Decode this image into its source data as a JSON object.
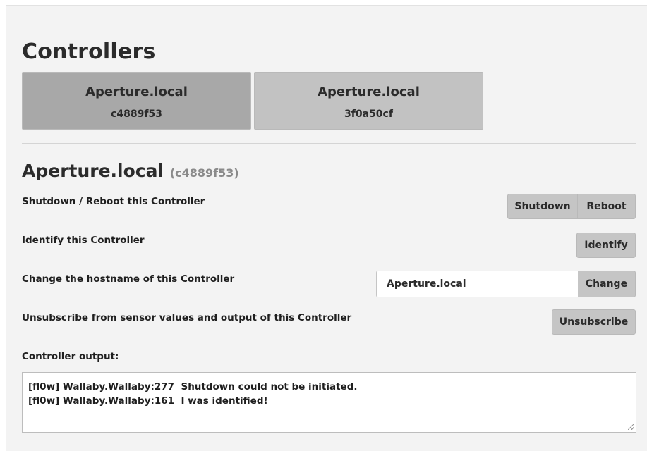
{
  "page": {
    "title": "Controllers"
  },
  "controllers": [
    {
      "name": "Aperture.local",
      "id": "c4889f53",
      "active": true
    },
    {
      "name": "Aperture.local",
      "id": "3f0a50cf",
      "active": false
    }
  ],
  "selected": {
    "name": "Aperture.local",
    "id_paren": "(c4889f53)"
  },
  "rows": {
    "power_label": "Shutdown / Reboot this Controller",
    "shutdown_label": "Shutdown",
    "reboot_label": "Reboot",
    "identify_row_label": "Identify this Controller",
    "identify_button_label": "Identify",
    "hostname_label": "Change the hostname of this Controller",
    "hostname_value": "Aperture.local",
    "change_button_label": "Change",
    "unsubscribe_row_label": "Unsubscribe from sensor values and output of this Controller",
    "unsubscribe_button_label": "Unsubscribe",
    "output_label": "Controller output:"
  },
  "output_lines": [
    "[fl0w] Wallaby.Wallaby:277  Shutdown could not be initiated.",
    "[fl0w] Wallaby.Wallaby:161  I was identified!"
  ],
  "colors": {
    "panel_bg": "#f3f3f3",
    "tab_active": "#a8a8a8",
    "tab_inactive": "#c2c2c2",
    "button_bg": "#c5c5c5"
  }
}
